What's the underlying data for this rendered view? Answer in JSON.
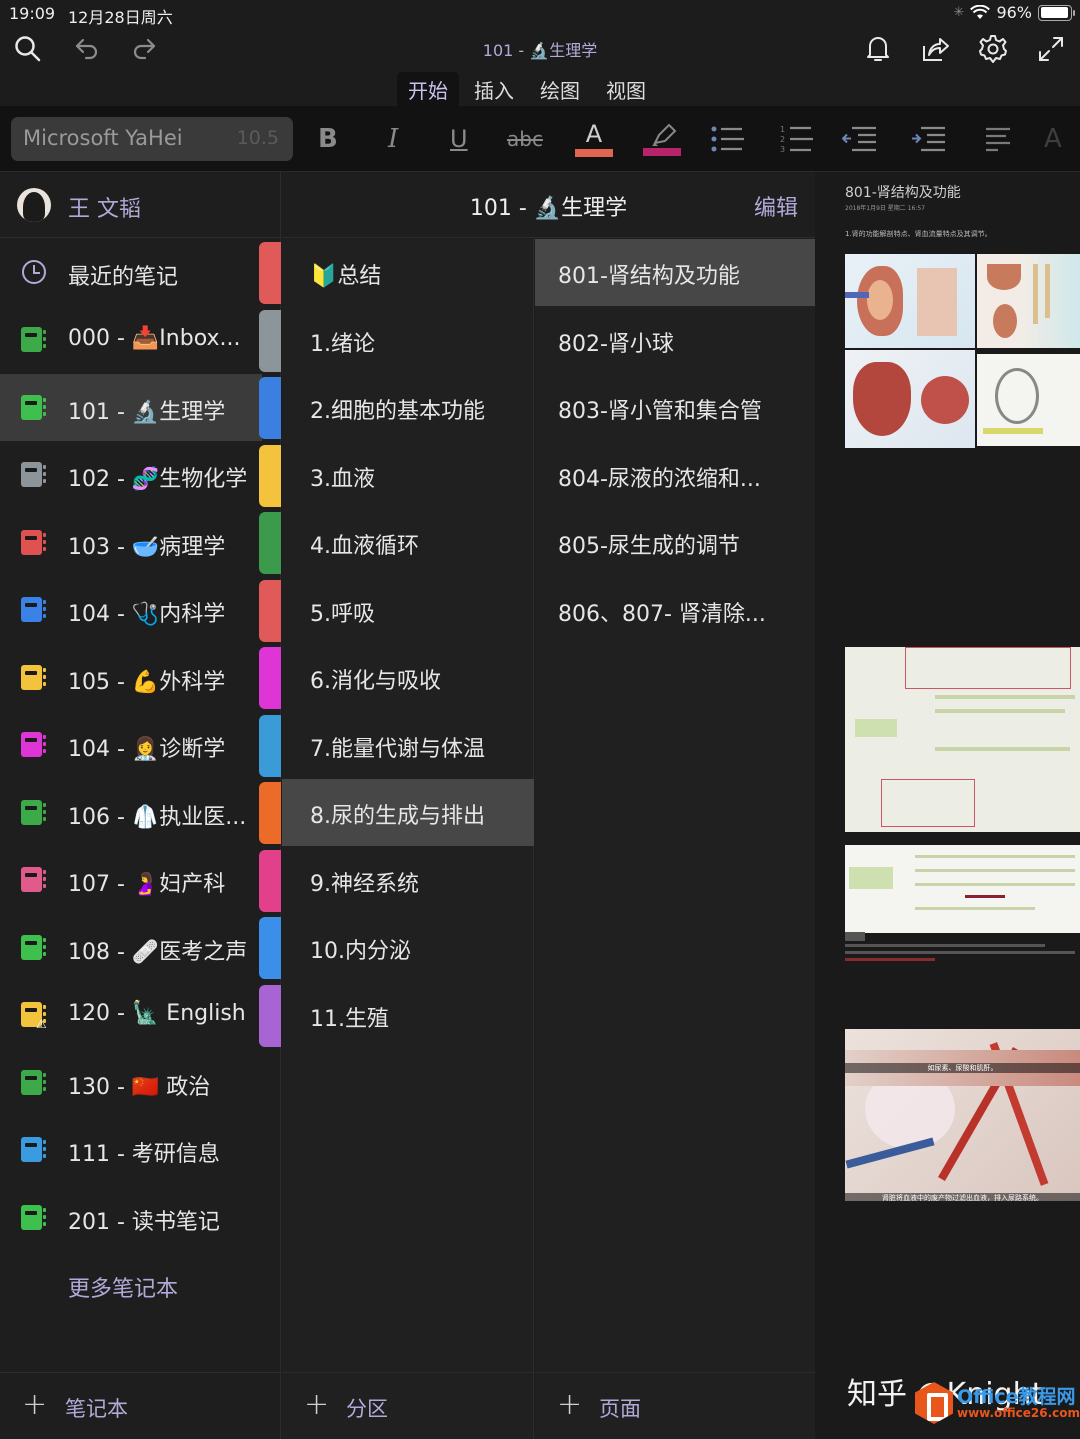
{
  "status_bar": {
    "time": "19:09",
    "date": "12月28日周六",
    "battery_text": "96%",
    "battery_level": 0.96
  },
  "top_bar": {
    "document_title": "101 - 🔬生理学",
    "icons": [
      "search-icon",
      "undo-icon",
      "redo-icon",
      "bell-icon",
      "share-icon",
      "gear-icon",
      "fullscreen-icon"
    ]
  },
  "ribbon": {
    "tabs": [
      {
        "label": "开始",
        "active": true
      },
      {
        "label": "插入",
        "active": false
      },
      {
        "label": "绘图",
        "active": false
      },
      {
        "label": "视图",
        "active": false
      }
    ]
  },
  "format_toolbar": {
    "font_name": "Microsoft YaHei",
    "font_size": "10.5",
    "bold": "B",
    "italic": "I",
    "underline": "U",
    "strikethrough": "abc",
    "font_color_glyph": "A",
    "font_color": "#e0664f",
    "highlight_color": "#b8246a",
    "clear_format_glyph": "A"
  },
  "user": {
    "name": "王 文韬"
  },
  "notebooks": {
    "recent_label": "最近的笔记",
    "items": [
      {
        "label": "000 - 📥Inbox...",
        "color": "#3daa4a",
        "selected": false
      },
      {
        "label": "101 - 🔬生理学",
        "color": "#3fbf4e",
        "selected": true
      },
      {
        "label": "102 - 🧬生物化学",
        "color": "#8c969a",
        "selected": false
      },
      {
        "label": "103 - 🥣病理学",
        "color": "#e05252",
        "selected": false
      },
      {
        "label": "104 - 🩺内科学",
        "color": "#3b82e8",
        "selected": false
      },
      {
        "label": "105 - 💪外科学",
        "color": "#f3c33e",
        "selected": false
      },
      {
        "label": "104 - 👩‍⚕️诊断学",
        "color": "#de35d6",
        "selected": false
      },
      {
        "label": "106 - 🥼执业医...",
        "color": "#3daa4a",
        "selected": false
      },
      {
        "label": "107 - 🤰妇产科",
        "color": "#e05a8c",
        "selected": false
      },
      {
        "label": "108 - 🩹医考之声",
        "color": "#3fbf4e",
        "selected": false
      },
      {
        "label": "120 - 🗽 English",
        "color": "#f3c33e",
        "selected": false,
        "warning": true
      },
      {
        "label": "130 - 🇨🇳 政治",
        "color": "#3daa4a",
        "selected": false
      },
      {
        "label": "111 - 考研信息",
        "color": "#3b9be0",
        "selected": false
      },
      {
        "label": "201 - 读书笔记",
        "color": "#3fbf4e",
        "selected": false
      }
    ],
    "more_label": "更多笔记本",
    "add_label": "笔记本"
  },
  "section_tab_colors": [
    "#e05a5a",
    "#8c969a",
    "#3b7fe0",
    "#f3c33e",
    "#3b9a4c",
    "#e05a5a",
    "#de35d6",
    "#3b9ad8",
    "#ec6b29",
    "#e3408c",
    "#3b8fe8",
    "#a864d3"
  ],
  "sections": {
    "header_title": "101 - 🔬生理学",
    "edit_label": "编辑",
    "items": [
      {
        "label": "🔰总结",
        "selected": false
      },
      {
        "label": "1.绪论",
        "selected": false
      },
      {
        "label": "2.细胞的基本功能",
        "selected": false
      },
      {
        "label": "3.血液",
        "selected": false
      },
      {
        "label": "4.血液循环",
        "selected": false
      },
      {
        "label": "5.呼吸",
        "selected": false
      },
      {
        "label": "6.消化与吸收",
        "selected": false
      },
      {
        "label": "7.能量代谢与体温",
        "selected": false
      },
      {
        "label": "8.尿的生成与排出",
        "selected": true
      },
      {
        "label": "9.神经系统",
        "selected": false
      },
      {
        "label": "10.内分泌",
        "selected": false
      },
      {
        "label": "11.生殖",
        "selected": false
      }
    ],
    "add_label": "分区"
  },
  "pages": {
    "items": [
      {
        "label": "801-肾结构及功能",
        "selected": true
      },
      {
        "label": "802-肾小球",
        "selected": false
      },
      {
        "label": "803-肾小管和集合管",
        "selected": false
      },
      {
        "label": "804-尿液的浓缩和...",
        "selected": false
      },
      {
        "label": "805-尿生成的调节",
        "selected": false
      },
      {
        "label": "806、807- 肾清除...",
        "selected": false
      }
    ],
    "add_label": "页面"
  },
  "preview": {
    "title": "801-肾结构及功能",
    "date": "2018年1月9日 星期二      16:57",
    "first_line": "1.肾的功能解剖特点、肾血流量特点及其调节。",
    "caption_1": "肾脏将血液中的废产物过滤出血液，排入尿路系统。",
    "caption_2": "如尿素、尿酸和肌酐。"
  },
  "watermark": {
    "text": "知乎 @Knight",
    "brand": "Office教程网",
    "url": "www.office26.com"
  }
}
